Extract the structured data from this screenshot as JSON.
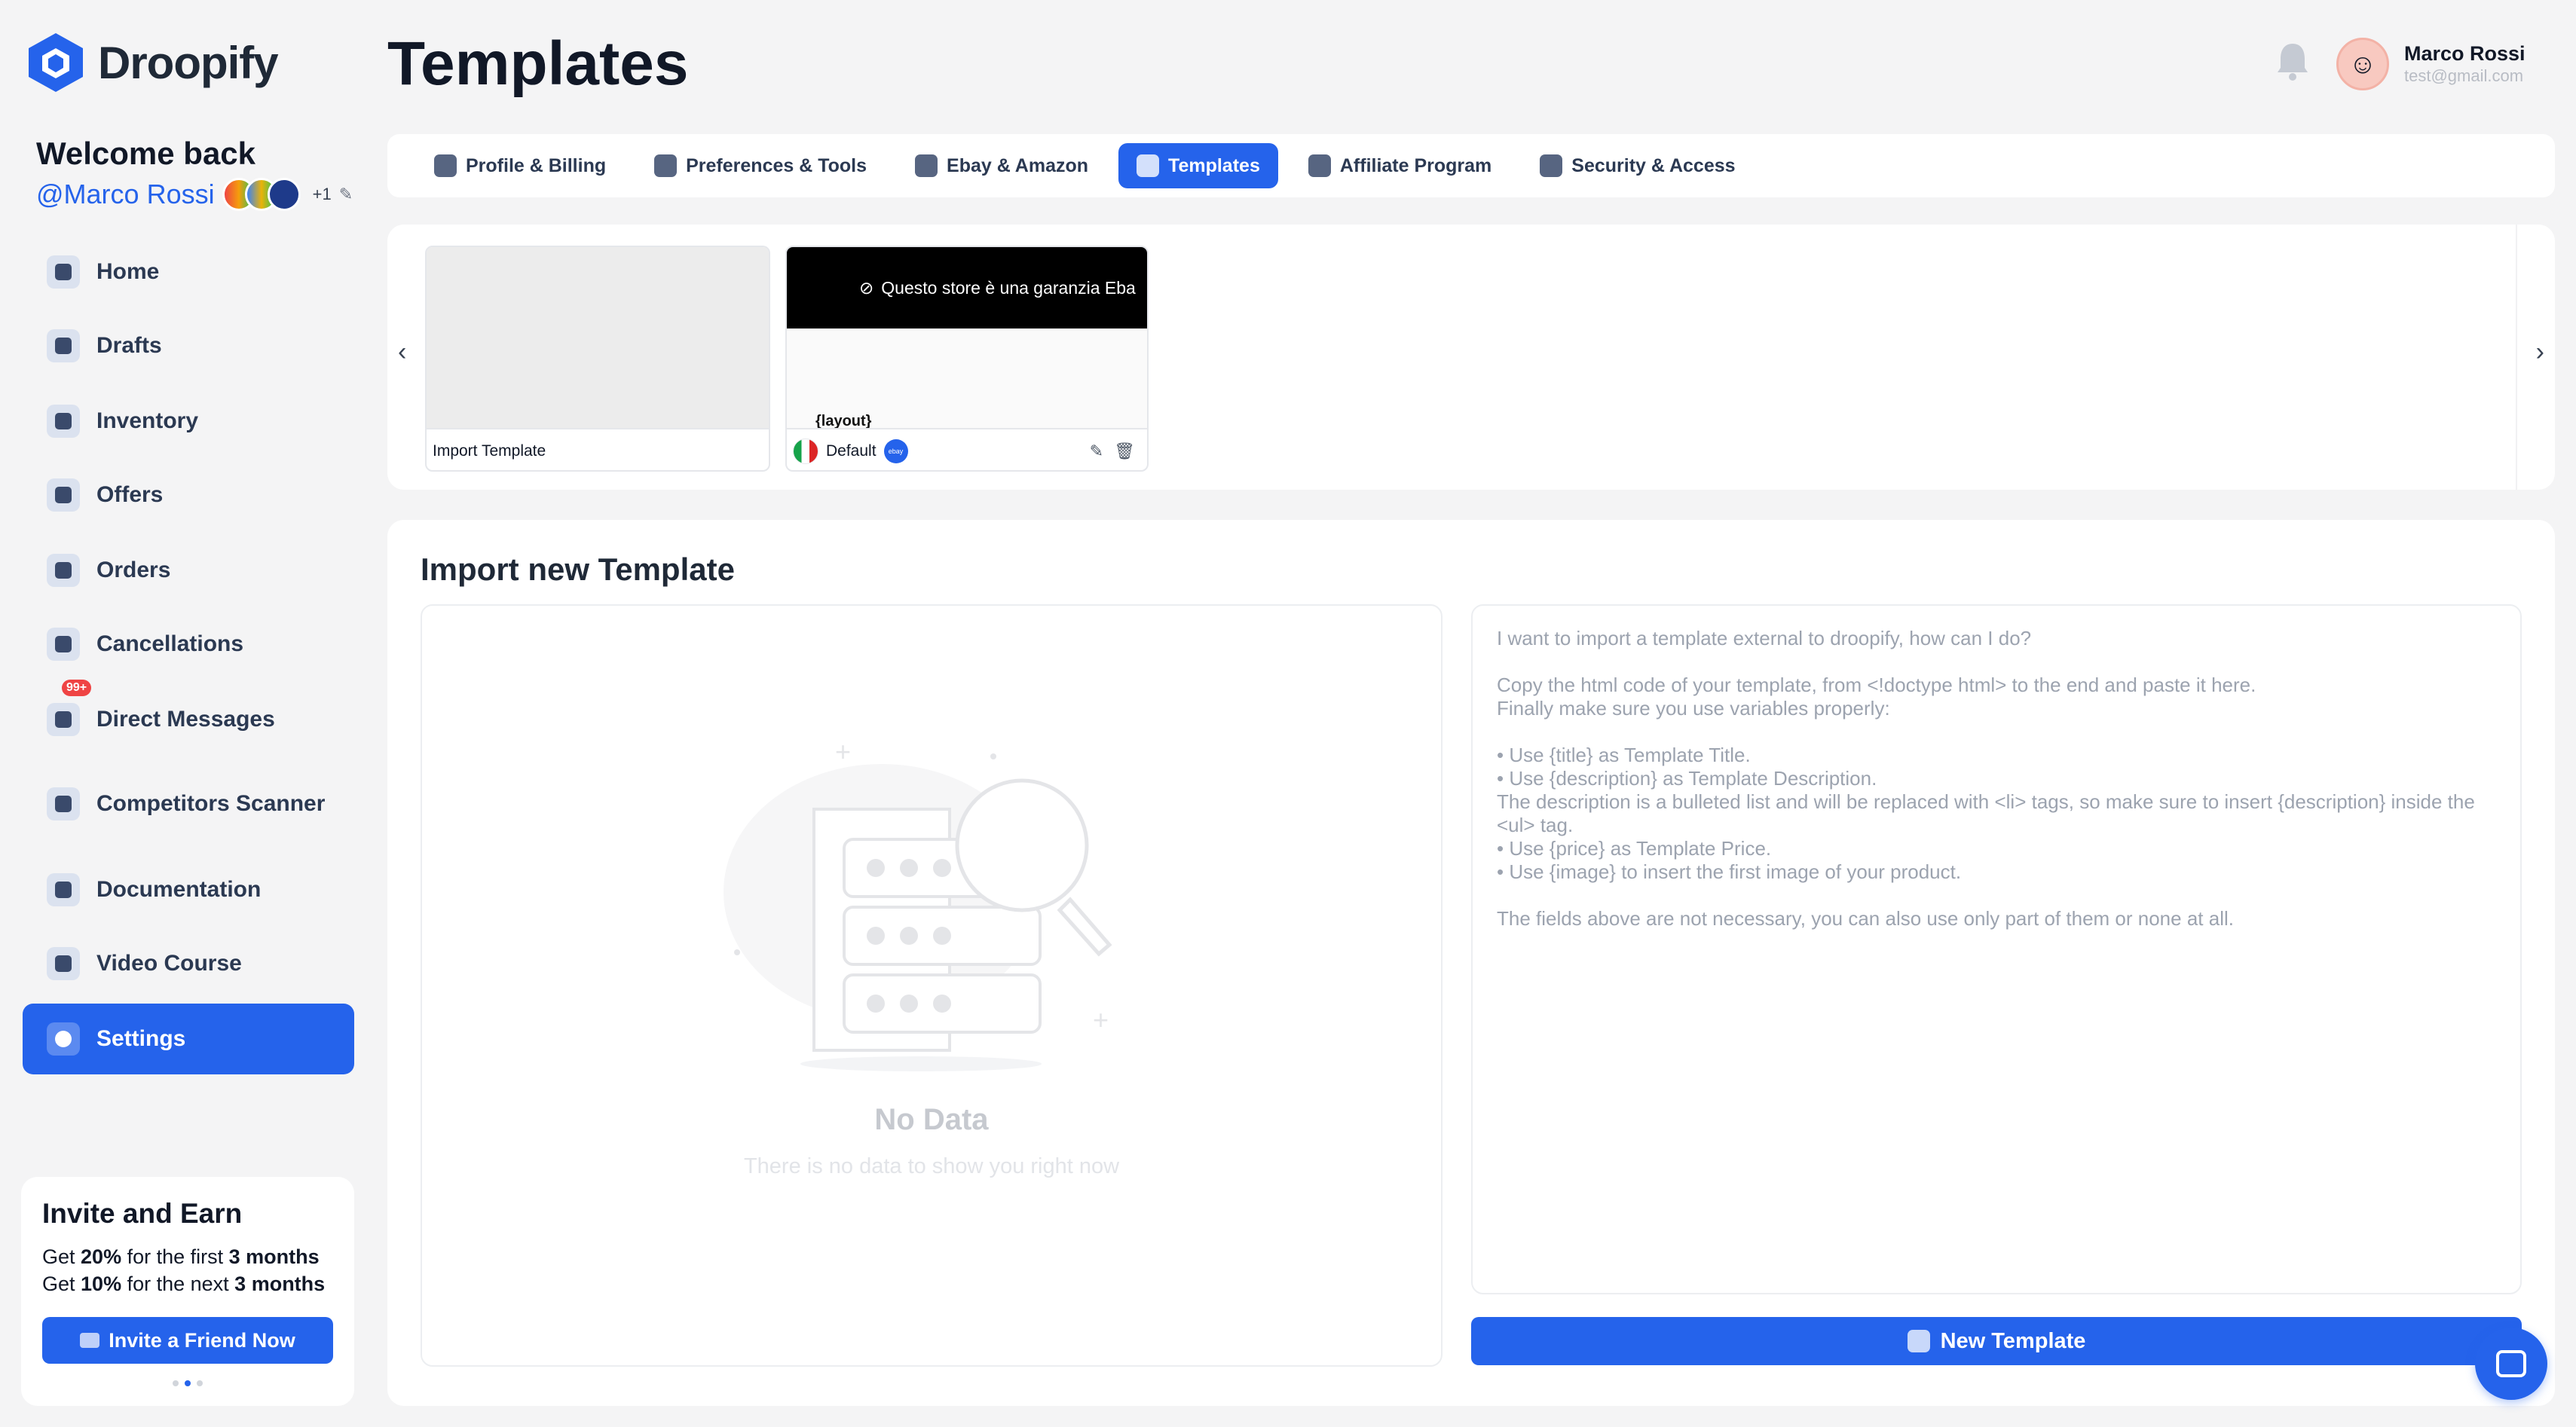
{
  "brand": {
    "name": "Droopify",
    "accent": "#2563eb"
  },
  "sidebar": {
    "welcome": "Welcome back",
    "username": "@Marco Rossi",
    "extra_count": "+1",
    "items": [
      {
        "label": "Home",
        "icon": "home-icon"
      },
      {
        "label": "Drafts",
        "icon": "drafts-icon"
      },
      {
        "label": "Inventory",
        "icon": "briefcase-icon"
      },
      {
        "label": "Offers",
        "icon": "percent-icon"
      },
      {
        "label": "Orders",
        "icon": "cart-icon"
      },
      {
        "label": "Cancellations",
        "icon": "arrow-left-icon"
      },
      {
        "label": "Direct Messages",
        "icon": "megaphone-icon",
        "badge": "99+"
      },
      {
        "label": "Competitors Scanner",
        "icon": "scanner-icon"
      },
      {
        "label": "Documentation",
        "icon": "document-icon"
      },
      {
        "label": "Video Course",
        "icon": "book-icon"
      },
      {
        "label": "Settings",
        "icon": "gear-icon",
        "active": true
      }
    ],
    "invite": {
      "title": "Invite and Earn",
      "line1_a": "Get ",
      "line1_b": "20%",
      "line1_c": " for the first ",
      "line1_d": "3 months",
      "line2_a": "Get ",
      "line2_b": "10%",
      "line2_c": " for the next ",
      "line2_d": "3 months",
      "button": "Invite a Friend Now"
    }
  },
  "header": {
    "title": "Templates",
    "user_name": "Marco Rossi",
    "user_email": "test@gmail.com"
  },
  "tabs": [
    {
      "label": "Profile & Billing",
      "icon": "gear-icon"
    },
    {
      "label": "Preferences & Tools",
      "icon": "sliders-icon"
    },
    {
      "label": "Ebay & Amazon",
      "icon": "user-add-icon"
    },
    {
      "label": "Templates",
      "icon": "image-icon",
      "active": true
    },
    {
      "label": "Affiliate Program",
      "icon": "users-icon"
    },
    {
      "label": "Security & Access",
      "icon": "lock-icon"
    }
  ],
  "templates": [
    {
      "name": "Import Template"
    },
    {
      "name": "Default",
      "banner": "Questo store è una garanzia Eba",
      "fragment": "{layout}"
    }
  ],
  "import_panel": {
    "title": "Import new Template",
    "empty_title": "No Data",
    "empty_sub": "There is no data to show you right now",
    "help": {
      "q": "I want to import a template external to droopify, how can I do?",
      "p1": "Copy the html code of your template, from <!doctype html> to the end and paste it here.",
      "p2": "Finally make sure you use variables properly:",
      "b1": "• Use {title} as Template Title.",
      "b2": "• Use {description} as Template Description.",
      "b3": "The description is a bulleted list and will be replaced with <li> tags, so make sure to insert {description} inside the <ul> tag.",
      "b4": "• Use {price} as Template Price.",
      "b5": "• Use {image} to insert the first image of your product.",
      "note": "The fields above are not necessary, you can also use only part of them or none at all."
    },
    "button": "New Template"
  }
}
